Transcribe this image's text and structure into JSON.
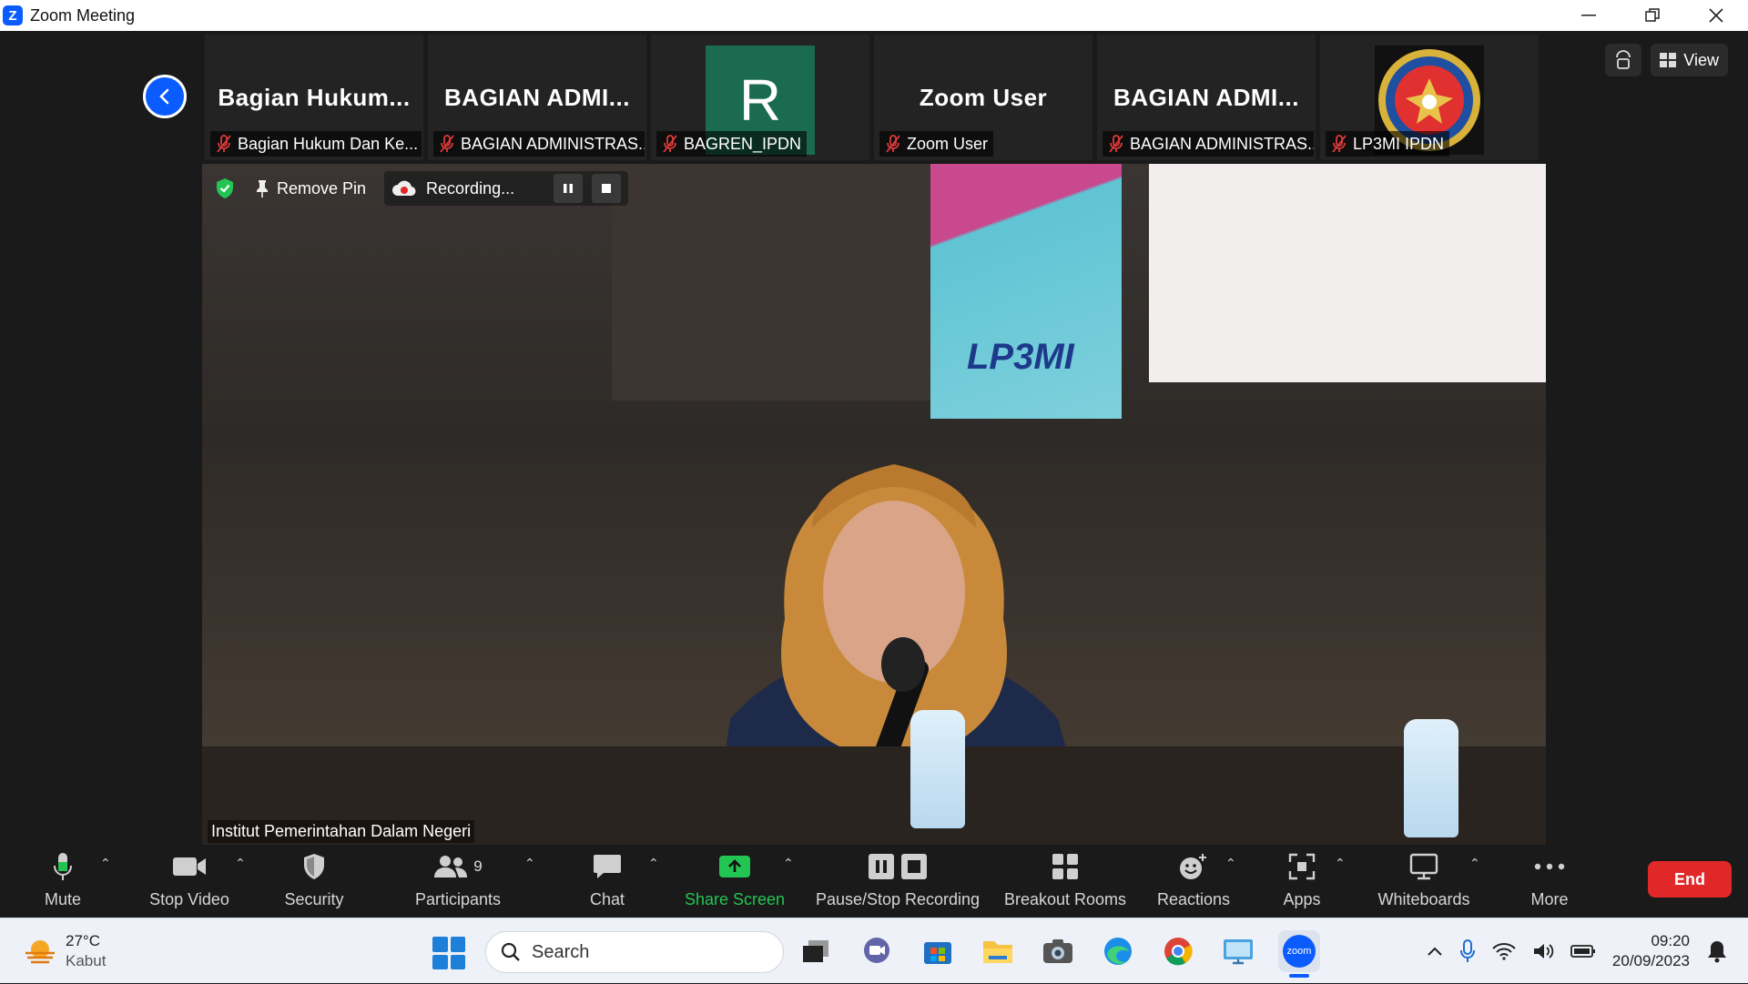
{
  "window": {
    "app_letter": "Z",
    "title": "Zoom Meeting"
  },
  "participants_strip": [
    {
      "tile_name": "Bagian  Hukum...",
      "label": "Bagian Hukum Dan Ke..."
    },
    {
      "tile_name": "BAGIAN  ADMI...",
      "label": "BAGIAN ADMINISTRAS..."
    },
    {
      "tile_name": "",
      "avatar_letter": "R",
      "label": "BAGREN_IPDN"
    },
    {
      "tile_name": "Zoom User",
      "label": "Zoom User"
    },
    {
      "tile_name": "BAGIAN  ADMI...",
      "label": "BAGIAN ADMINISTRAS..."
    },
    {
      "tile_name": "",
      "label": "LP3MI IPDN"
    }
  ],
  "top_right": {
    "view_label": "View"
  },
  "main_video": {
    "remove_pin_label": "Remove Pin",
    "recording_label": "Recording...",
    "speaker_label": "Institut Pemerintahan Dalam Negeri",
    "banner_text": "LP3MI"
  },
  "toolbar": {
    "mute": "Mute",
    "stop_video": "Stop Video",
    "security": "Security",
    "participants": "Participants",
    "participants_count": "9",
    "chat": "Chat",
    "share_screen": "Share Screen",
    "pause_stop_recording": "Pause/Stop Recording",
    "breakout_rooms": "Breakout Rooms",
    "reactions": "Reactions",
    "apps": "Apps",
    "whiteboards": "Whiteboards",
    "more": "More",
    "end": "End"
  },
  "taskbar": {
    "temperature": "27°C",
    "weather": "Kabut",
    "search_placeholder": "Search",
    "zoom_app_label": "zoom",
    "time": "09:20",
    "date": "20/09/2023"
  },
  "colors": {
    "zoom_blue": "#0b5cff",
    "end_red": "#e02828",
    "share_green": "#23c552",
    "meeting_bg": "#1a1a1a"
  }
}
